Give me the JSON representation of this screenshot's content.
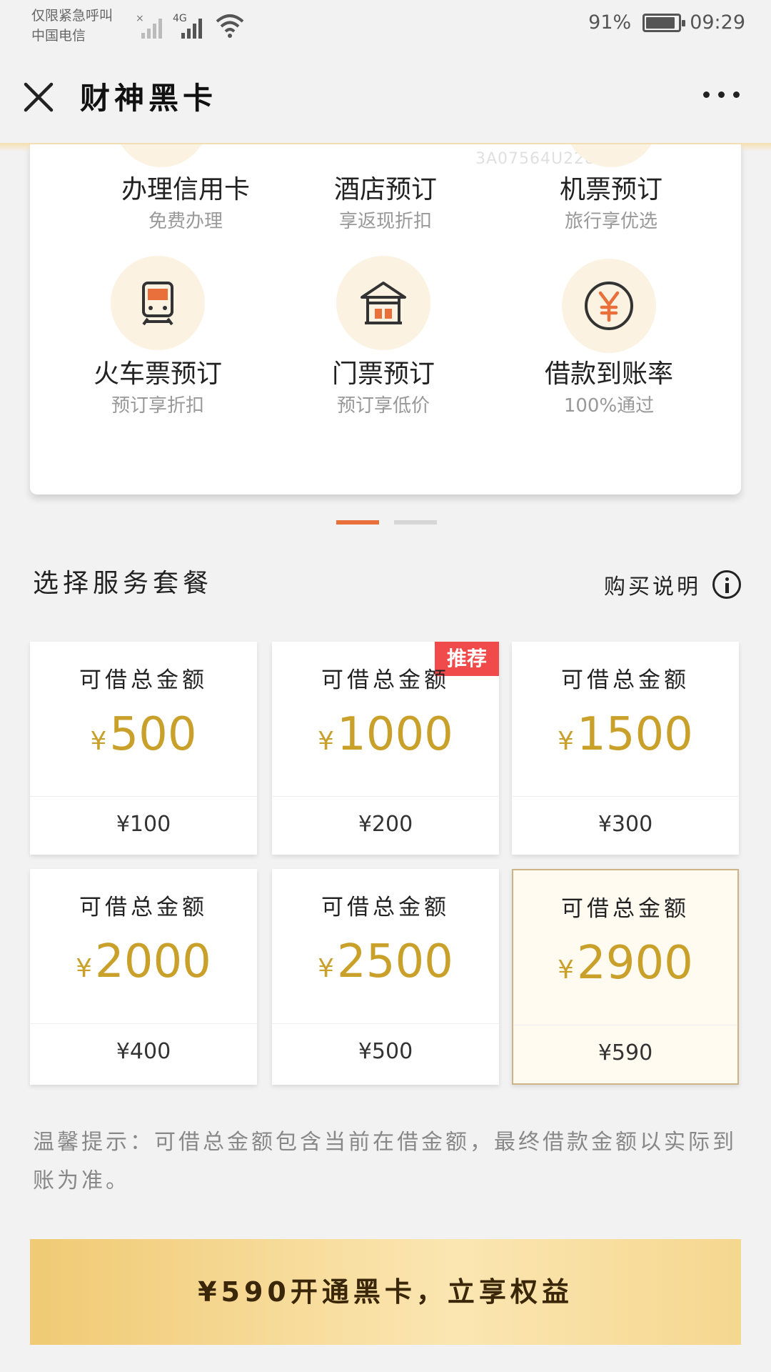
{
  "status_bar": {
    "carrier_line1": "仅限紧急呼叫",
    "carrier_line2": "中国电信",
    "network": "4G",
    "battery": "91%",
    "battery_level": 0.91,
    "time": "09:29"
  },
  "header": {
    "title": "财神黑卡"
  },
  "card": {
    "top_label": "3A07564U228",
    "features": [
      {
        "title": "办理信用卡",
        "subtitle": "免费办理",
        "icon": "credit-card-icon"
      },
      {
        "title": "酒店预订",
        "subtitle": "享返现折扣",
        "icon": "hotel-icon"
      },
      {
        "title": "机票预订",
        "subtitle": "旅行享优选",
        "icon": "plane-icon"
      },
      {
        "title": "火车票预订",
        "subtitle": "预订享折扣",
        "icon": "train-icon"
      },
      {
        "title": "门票预订",
        "subtitle": "预订享低价",
        "icon": "pavilion-icon"
      },
      {
        "title": "借款到账率",
        "subtitle": "100%通过",
        "icon": "yen-icon"
      }
    ]
  },
  "section": {
    "title": "选择服务套餐",
    "buy_info": "购买说明"
  },
  "plans": [
    {
      "label": "可借总金额",
      "yen": "¥",
      "amount": "500",
      "price": "¥100",
      "badge": "",
      "selected": false
    },
    {
      "label": "可借总金额",
      "yen": "¥",
      "amount": "1000",
      "price": "¥200",
      "badge": "推荐",
      "selected": false
    },
    {
      "label": "可借总金额",
      "yen": "¥",
      "amount": "1500",
      "price": "¥300",
      "badge": "",
      "selected": false
    },
    {
      "label": "可借总金额",
      "yen": "¥",
      "amount": "2000",
      "price": "¥400",
      "badge": "",
      "selected": false
    },
    {
      "label": "可借总金额",
      "yen": "¥",
      "amount": "2500",
      "price": "¥500",
      "badge": "",
      "selected": false
    },
    {
      "label": "可借总金额",
      "yen": "¥",
      "amount": "2900",
      "price": "¥590",
      "badge": "",
      "selected": true
    }
  ],
  "tip": "温馨提示：可借总金额包含当前在借金额，最终借款金额以实际到账为准。",
  "cta": "¥590开通黑卡，立享权益",
  "colors": {
    "accent_orange": "#e9703a",
    "gold_amount": "#c9a02a",
    "badge_red": "#f04a4a",
    "icon_bubble": "#fbf2e2"
  }
}
